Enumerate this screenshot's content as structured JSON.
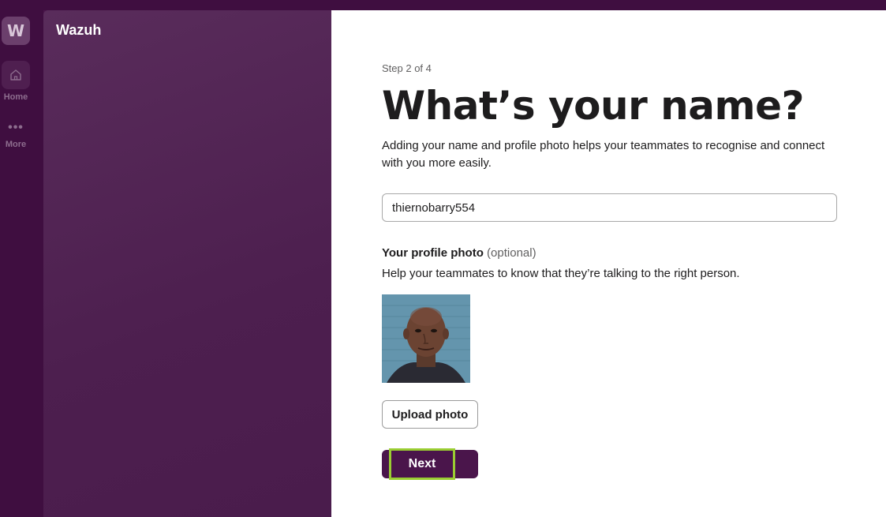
{
  "app": {
    "workspace_initial": "W",
    "workspace_name": "Wazuh"
  },
  "rail": {
    "home_label": "Home",
    "more_label": "More",
    "home_icon": "house-icon",
    "more_icon": "ellipsis-icon"
  },
  "form": {
    "step": "Step 2 of 4",
    "title": "What’s your name?",
    "description": "Adding your name and profile photo helps your teammates to recognise and connect with you more easily.",
    "name_value": "thiernobarry554",
    "photo_label": "Your profile photo",
    "photo_optional": "(optional)",
    "photo_help": "Help your teammates to know that they’re talking to the right person.",
    "upload_label": "Upload photo",
    "next_label": "Next"
  },
  "colors": {
    "brand": "#4a154b",
    "focus_ring": "#9acd32"
  }
}
